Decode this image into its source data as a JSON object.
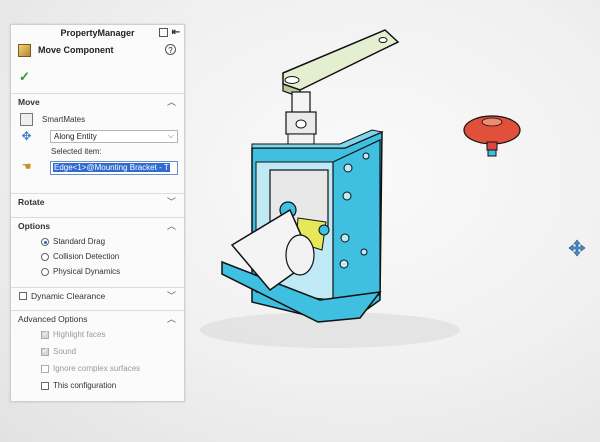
{
  "panel": {
    "title": "PropertyManager",
    "feature_name": "Move Component",
    "help_label": "?",
    "ok_label": "✓"
  },
  "move": {
    "header": "Move",
    "smartmates_label": "SmartMates",
    "mode_value": "Along Entity",
    "selected_item_label": "Selected item:",
    "selected_item_value": "Edge<1>@Mounting Bracket - T"
  },
  "rotate": {
    "header": "Rotate"
  },
  "options": {
    "header": "Options",
    "radios": [
      {
        "label": "Standard Drag",
        "selected": true
      },
      {
        "label": "Collision Detection",
        "selected": false
      },
      {
        "label": "Physical Dynamics",
        "selected": false
      }
    ]
  },
  "dynamic_clearance": {
    "label": "Dynamic Clearance"
  },
  "advanced": {
    "header": "Advanced Options",
    "items": [
      {
        "label": "Highlight faces",
        "checked": true,
        "disabled": true
      },
      {
        "label": "Sound",
        "checked": true,
        "disabled": true
      },
      {
        "label": "Ignore complex surfaces",
        "checked": false,
        "disabled": true
      },
      {
        "label": "This configuration",
        "checked": false,
        "disabled": false
      }
    ]
  },
  "icons": {
    "move_component": "move-component-icon",
    "smartmates": "smartmates-icon",
    "move_mode": "move-arrows-icon",
    "selected_item": "hand-pointer-icon"
  },
  "colors": {
    "bracket": "#3fc0e0",
    "gray_part": "#f2f2f2",
    "handle": "#dde9c4",
    "knob": "#e0503a",
    "selection": "#2f6bd1"
  }
}
